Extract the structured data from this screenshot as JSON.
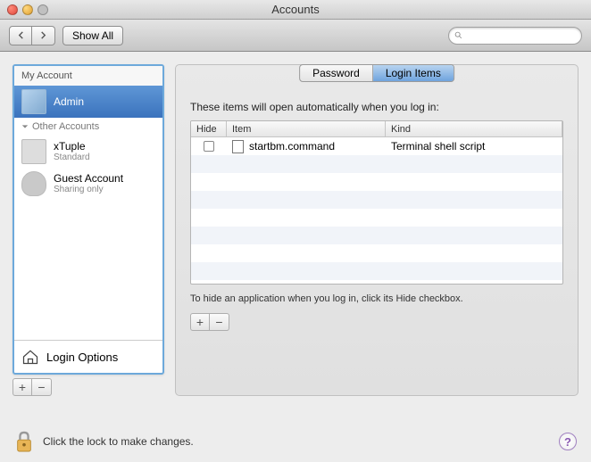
{
  "window": {
    "title": "Accounts"
  },
  "toolbar": {
    "show_all": "Show All",
    "search_placeholder": ""
  },
  "sidebar": {
    "section_my": "My Account",
    "admin_name": "Admin",
    "section_other": "Other Accounts",
    "xtuple_name": "xTuple",
    "xtuple_sub": "Standard",
    "guest_name": "Guest Account",
    "guest_sub": "Sharing only",
    "login_options": "Login Options"
  },
  "tabs": {
    "password": "Password",
    "login_items": "Login Items"
  },
  "content": {
    "desc": "These items will open automatically when you log in:",
    "col_hide": "Hide",
    "col_item": "Item",
    "col_kind": "Kind",
    "hint": "To hide an application when you log in, click its Hide checkbox."
  },
  "items": [
    {
      "name": "startbm.command",
      "kind": "Terminal shell script",
      "hide": false
    }
  ],
  "footer": {
    "lock_text": "Click the lock to make changes."
  }
}
